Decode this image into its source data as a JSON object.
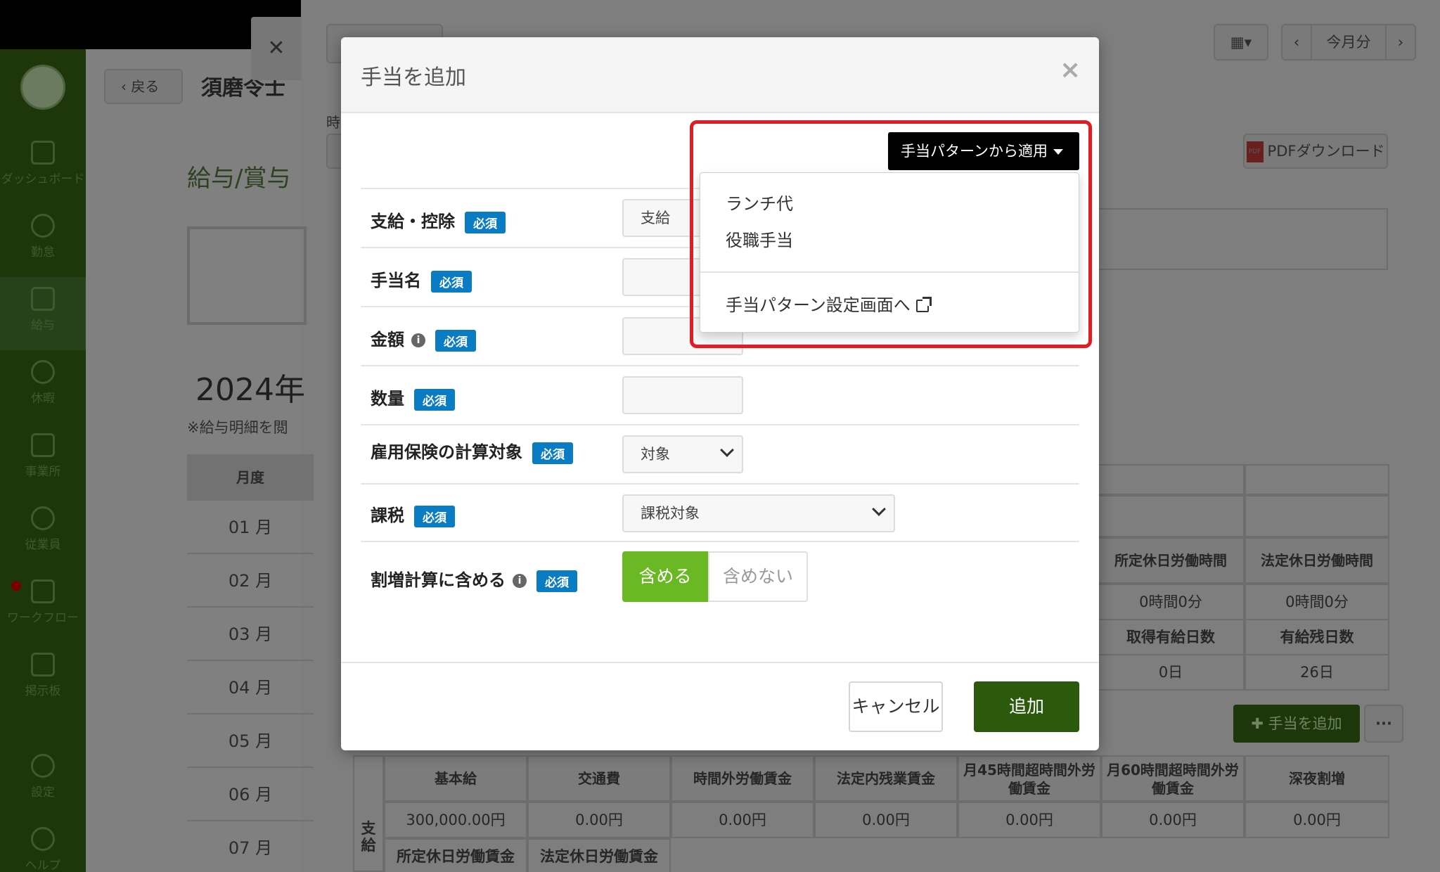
{
  "sidebar": {
    "items": [
      {
        "label": "ダッシュボード",
        "icon": "grid-icon"
      },
      {
        "label": "勤怠",
        "icon": "clock-icon"
      },
      {
        "label": "給与",
        "icon": "calculator-icon"
      },
      {
        "label": "休暇",
        "icon": "umbrella-icon"
      },
      {
        "label": "事業所",
        "icon": "home-icon"
      },
      {
        "label": "従業員",
        "icon": "user-icon"
      },
      {
        "label": "ワークフロー",
        "icon": "checklist-icon"
      },
      {
        "label": "掲示板",
        "icon": "message-icon"
      },
      {
        "label": "設定",
        "icon": "gear-icon"
      },
      {
        "label": "ヘルプ",
        "icon": "help-icon"
      }
    ]
  },
  "background": {
    "back_label": "戻る",
    "employee_name": "須磨令士",
    "section_title": "給与/賞与",
    "year": "2024年",
    "note": "※給与明細を閲",
    "month_header": "月度",
    "months": [
      "01 月",
      "02 月",
      "03 月",
      "04 月",
      "05 月",
      "06 月",
      "07 月"
    ],
    "current_month_label": "今月分",
    "pdf_label": "PDFダウンロード",
    "pdf_badge": "PDF",
    "time_label": "時",
    "summary_headers": [
      "所定休日労働時間",
      "法定休日労働時間"
    ],
    "summary_values": [
      "0時間0分",
      "0時間0分"
    ],
    "leave_headers": [
      "取得有給日数",
      "有給残日数"
    ],
    "leave_values": [
      "0日",
      "26日"
    ],
    "add_allowance_label": "手当を追加",
    "more_label": "···",
    "payment_headers": [
      "基本給",
      "交通費",
      "時間外労働賃金",
      "法定内残業賃金",
      "月45時間超時間外労働賃金",
      "月60時間超時間外労働賃金",
      "深夜割増"
    ],
    "payment_values": [
      "300,000.00円",
      "0.00円",
      "0.00円",
      "0.00円",
      "0.00円",
      "0.00円",
      "0.00円"
    ],
    "payment_row_label": "支給",
    "payment_headers_2": [
      "所定休日労働賃金",
      "法定休日労働賃金"
    ]
  },
  "modal": {
    "title": "手当を追加",
    "close_label": "×",
    "pattern_button": "手当パターンから適用",
    "dropdown": {
      "items": [
        "ランチ代",
        "役職手当"
      ],
      "settings_link": "手当パターン設定画面へ"
    },
    "required_badge": "必須",
    "fields": {
      "type": {
        "label": "支給・控除",
        "value": "支給"
      },
      "name": {
        "label": "手当名",
        "value": ""
      },
      "amount": {
        "label": "金額",
        "value": ""
      },
      "quantity": {
        "label": "数量",
        "value": ""
      },
      "employment_insurance": {
        "label": "雇用保険の計算対象",
        "value": "対象"
      },
      "taxation": {
        "label": "課税",
        "value": "課税対象"
      },
      "premium": {
        "label": "割増計算に含める",
        "on": "含める",
        "off": "含めない"
      }
    },
    "cancel_label": "キャンセル",
    "submit_label": "追加"
  },
  "colors": {
    "required_badge": "#0a7cc3",
    "toggle_on": "#69b824",
    "submit": "#2b5a0c",
    "highlight": "#e31b23"
  }
}
